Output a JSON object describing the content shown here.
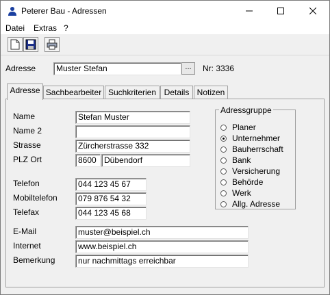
{
  "window": {
    "title": "Peterer Bau - Adressen",
    "minimize": "—",
    "maximize": "☐",
    "close": "✕"
  },
  "menu": [
    "Datei",
    "Extras",
    "?"
  ],
  "toolbar": {
    "icons": [
      "new-document-icon",
      "save-icon",
      "print-icon"
    ]
  },
  "header": {
    "adresse_label": "Adresse",
    "adresse_value": "Muster Stefan",
    "browse_label": "...",
    "nr_text": "Nr: 3336"
  },
  "tabs": [
    "Adresse",
    "Sachbearbeiter",
    "Suchkriterien",
    "Details",
    "Notizen"
  ],
  "form": {
    "name_label": "Name",
    "name_value": "Stefan Muster",
    "name2_label": "Name 2",
    "name2_value": "",
    "strasse_label": "Strasse",
    "strasse_value": "Zürcherstrasse 332",
    "plzort_label": "PLZ Ort",
    "plz_value": "8600",
    "ort_value": "Dübendorf",
    "telefon_label": "Telefon",
    "telefon_value": "044 123 45 67",
    "mobil_label": "Mobiltelefon",
    "mobil_value": "079 876 54 32",
    "telefax_label": "Telefax",
    "telefax_value": "044 123 45 68",
    "email_label": "E-Mail",
    "email_value": "muster@beispiel.ch",
    "internet_label": "Internet",
    "internet_value": "www.beispiel.ch",
    "bemerkung_label": "Bemerkung",
    "bemerkung_value": "nur nachmittags erreichbar"
  },
  "adressgruppe": {
    "title": "Adressgruppe",
    "options": [
      "Planer",
      "Unternehmer",
      "Bauherrschaft",
      "Bank",
      "Versicherung",
      "Behörde",
      "Werk",
      "Allg. Adresse"
    ],
    "selected": "Unternehmer"
  },
  "colors": {
    "accent": "#1a5fb4"
  }
}
